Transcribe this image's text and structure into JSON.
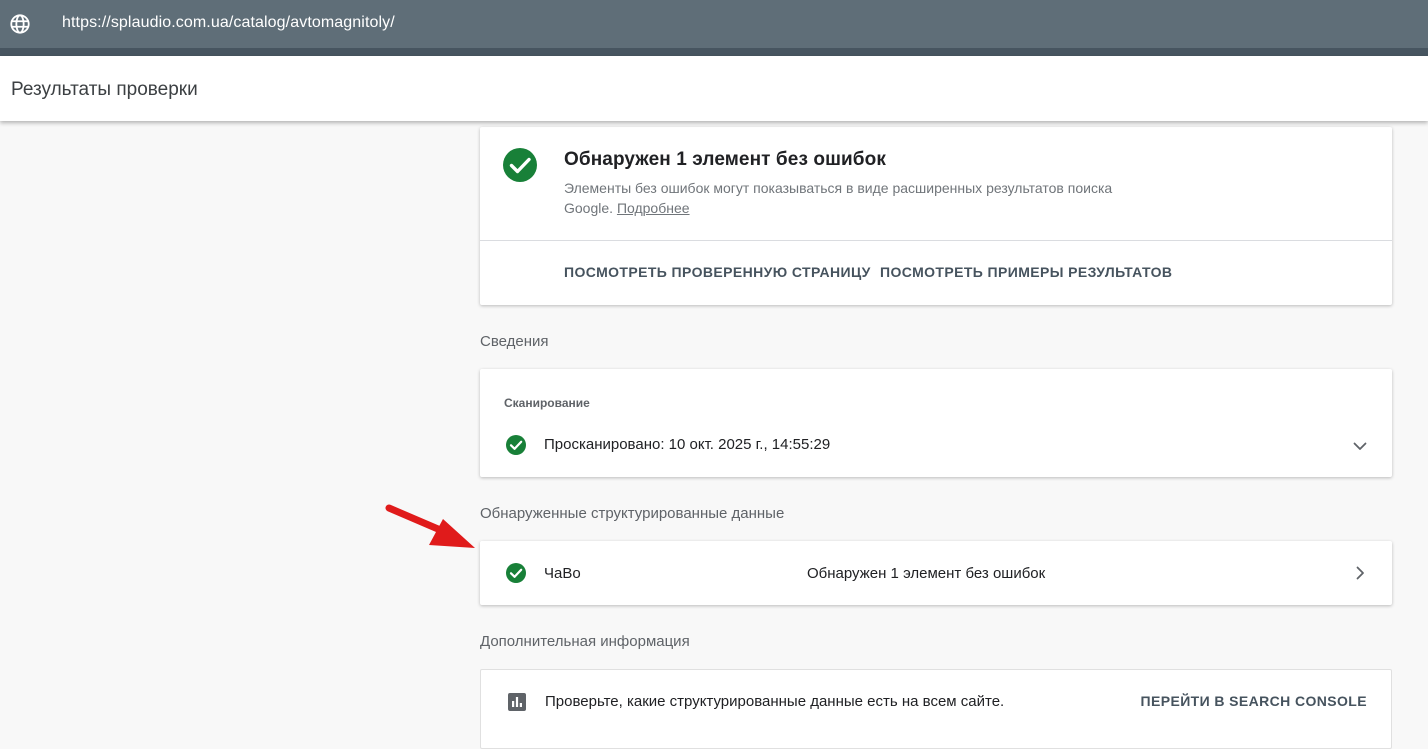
{
  "browser": {
    "url": "https://splaudio.com.ua/catalog/avtomagnitoly/",
    "icon": "globe-icon"
  },
  "header": {
    "title": "Результаты проверки"
  },
  "summary": {
    "title": "Обнаружен 1 элемент без ошибок",
    "description": "Элементы без ошибок могут показываться в виде расширенных результатов поиска Google.",
    "learn_more": "Подробнее",
    "view_page_button": "ПОСМОТРЕТЬ ПРОВЕРЕННУЮ СТРАНИЦУ",
    "view_examples_button": "ПОСМОТРЕТЬ ПРИМЕРЫ РЕЗУЛЬТАТОВ"
  },
  "details": {
    "section_label": "Сведения",
    "crawl": {
      "subtitle": "Сканирование",
      "text": "Просканировано: 10 окт. 2025 г., 14:55:29"
    }
  },
  "structured_data": {
    "section_label": "Обнаруженные структурированные данные",
    "items": [
      {
        "name": "ЧаВо",
        "status": "Обнаружен 1 элемент без ошибок"
      }
    ]
  },
  "additional": {
    "section_label": "Дополнительная информация",
    "text": "Проверьте, какие структурированные данные есть на всем сайте.",
    "console_button": "ПЕРЕЙТИ В SEARCH CONSOLE"
  },
  "colors": {
    "success": "#188038",
    "topbar": "#5f6e78",
    "arrow": "#e01b1b"
  }
}
